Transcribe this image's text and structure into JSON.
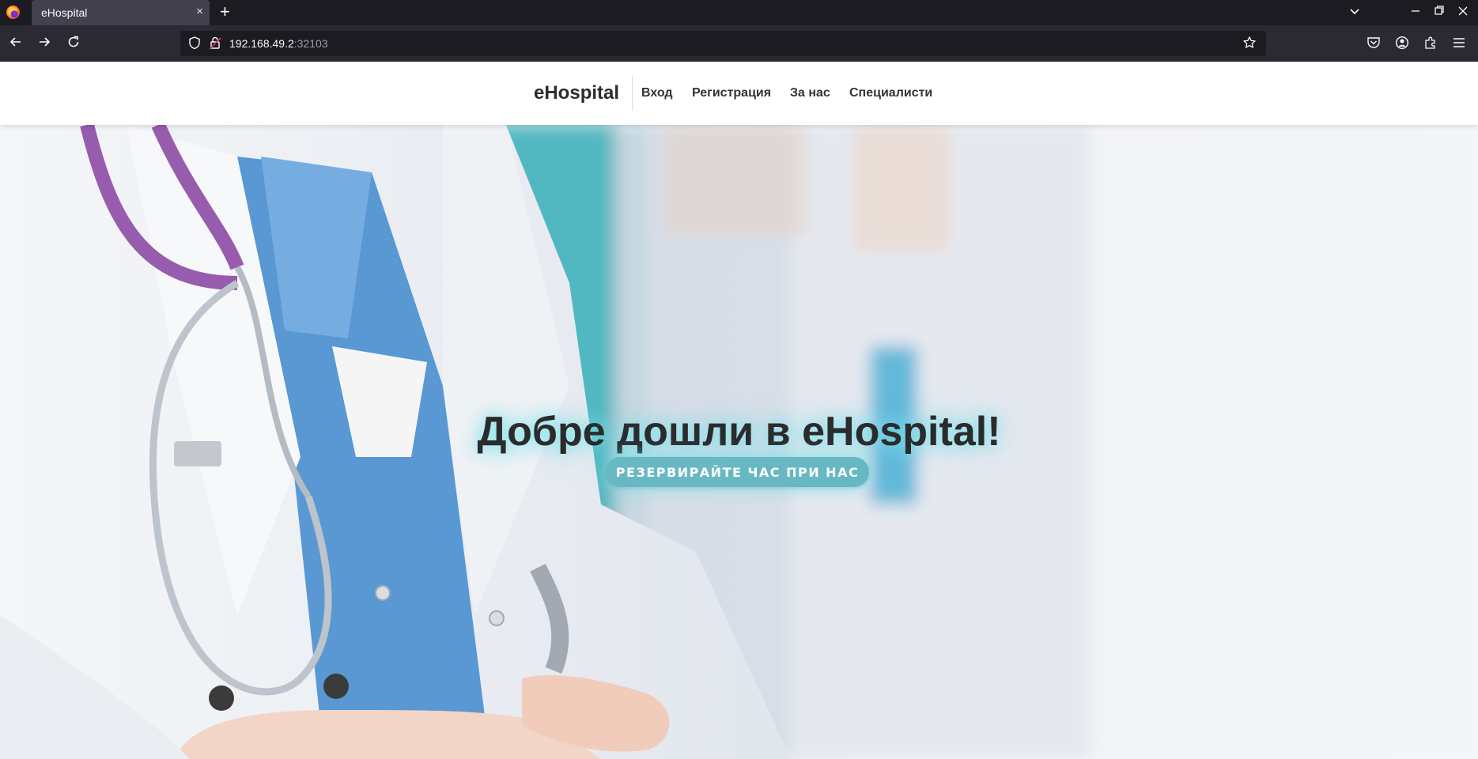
{
  "browser": {
    "tab_title": "eHospital",
    "tab_close": "×",
    "new_tab": "+",
    "url_host": "192.168.49.2",
    "url_port": ":32103"
  },
  "site": {
    "brand": "eHospital",
    "nav": {
      "login": "Вход",
      "register": "Регистрация",
      "about": "За нас",
      "specialists": "Специалисти"
    }
  },
  "hero": {
    "title": "Добре дошли в eHospital!",
    "cta_label": "РЕЗЕРВИРАЙТЕ ЧАС ПРИ НАС"
  },
  "colors": {
    "cta": "#68b8c3",
    "glow": "#7fe3ec",
    "chrome_dark": "#1c1b22",
    "chrome_toolbar": "#2b2a33"
  }
}
